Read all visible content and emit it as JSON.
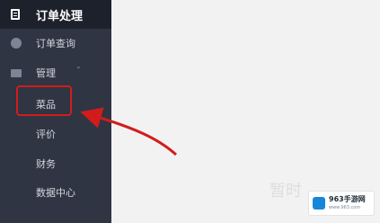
{
  "header": {
    "icon": "order-list-icon",
    "title": "订单处理"
  },
  "nav": {
    "query": {
      "label": "订单查询",
      "icon": "circle-icon"
    },
    "manage": {
      "label": "管理",
      "icon": "folder-icon",
      "chevron": "chevron-up-icon",
      "children": [
        "菜品",
        "评价",
        "财务",
        "数据中心"
      ]
    }
  },
  "main": {
    "placeholder": "暂时"
  },
  "watermark": {
    "title": "963手游网",
    "subtitle": "www.963.com"
  },
  "annotation": {
    "color": "#d21c1c"
  }
}
